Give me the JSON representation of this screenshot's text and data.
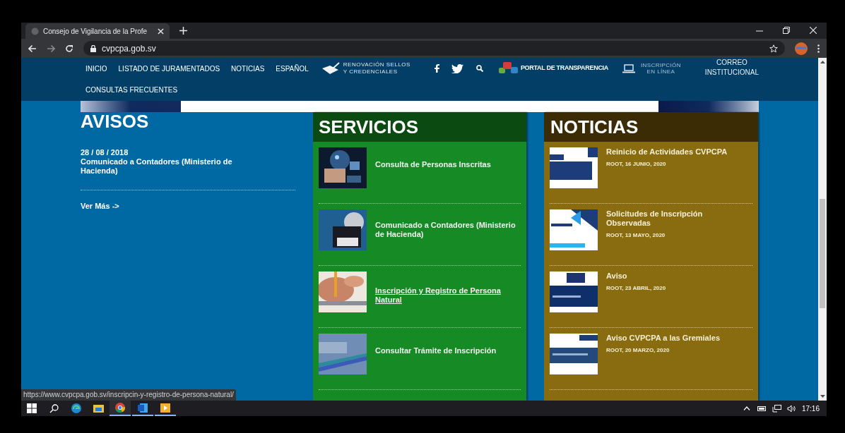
{
  "browser": {
    "tab_title": "Consejo de Vigilancia de la Profe",
    "url": "cvpcpa.gob.sv",
    "status_url": "https://www.cvpcpa.gob.sv/inscripcin-y-registro-de-persona-natural/"
  },
  "nav": {
    "items": [
      "INICIO",
      "LISTADO DE JURAMENTADOS",
      "NOTICIAS",
      "ESPAÑOL"
    ],
    "renovacion": [
      "RENOVACIÓN SELLOS",
      "Y CREDENCIALES"
    ],
    "portal": "PORTAL DE TRANSPARENCIA",
    "inscripcion": [
      "INSCRIPCIÓN",
      "EN LÍNEA"
    ],
    "correo": [
      "CORREO",
      "INSTITUCIONAL"
    ],
    "second_row": [
      "CONSULTAS FRECUENTES"
    ]
  },
  "avisos": {
    "title": "AVISOS",
    "items": [
      {
        "date": "28 / 08 / 2018",
        "text": "Comunicado a Contadores (Ministerio de Hacienda)"
      }
    ],
    "more": "Ver Más ->"
  },
  "servicios": {
    "title": "SERVICIOS",
    "items": [
      {
        "label": "Consulta de Personas Inscritas",
        "hovered": false
      },
      {
        "label": "Comunicado a Contadores (Ministerio de Hacienda)",
        "hovered": false
      },
      {
        "label": "Inscripción y Registro de Persona Natural",
        "hovered": true
      },
      {
        "label": "Consultar Trámite de Inscripción",
        "hovered": false
      }
    ]
  },
  "noticias": {
    "title": "NOTICIAS",
    "items": [
      {
        "title": "Reinicio de Actividades CVPCPA",
        "meta": "ROOT, 16 JUNIO, 2020"
      },
      {
        "title": "Solicitudes de Inscripción Observadas",
        "meta": "ROOT, 13 MAYO, 2020"
      },
      {
        "title": "Aviso",
        "meta": "ROOT, 23 ABRIL, 2020"
      },
      {
        "title": "Aviso CVPCPA a las Gremiales",
        "meta": "ROOT, 20 MARZO, 2020"
      }
    ]
  },
  "taskbar": {
    "clock": "17:16"
  }
}
